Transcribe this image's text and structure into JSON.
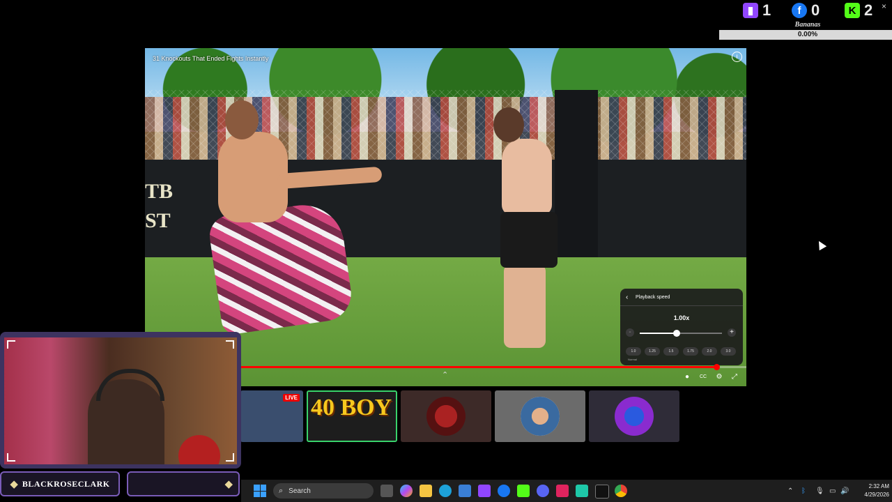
{
  "social": {
    "twitch_count": "1",
    "facebook_count": "0",
    "kick_count": "2",
    "close_glyph": "×",
    "goal_name": "Bananas",
    "goal_percent": "0.00%"
  },
  "player": {
    "video_title": "31 Knockouts That Ended Fights Instantly",
    "info_glyph": "i",
    "wall_text_line1": "TB",
    "wall_text_line2": "ST",
    "progress": 0.95,
    "expand_glyph": "⌃",
    "controls": [
      "●",
      "CC",
      "⚙",
      "⤢"
    ]
  },
  "speed_panel": {
    "back_glyph": "‹",
    "title": "Playback speed",
    "current": "1.00x",
    "minus_glyph": "-",
    "plus_glyph": "+",
    "slider_value": 0.45,
    "presets": [
      "1.0",
      "1.25",
      "1.5",
      "1.75",
      "2.0",
      "3.0"
    ],
    "normal_label": "Normal"
  },
  "recommendations": {
    "live_badge": "LIVE",
    "thumb_1_text": "40 BOY"
  },
  "streamer": {
    "name": "BLACKROSECLARK",
    "gem_glyph": "◆"
  },
  "taskbar": {
    "search_placeholder": "Search",
    "search_glyph": "⌕",
    "time": "2:32 AM",
    "date": "4/29/2026",
    "tray_glyphs": [
      "⌃",
      "ᛒ",
      "🎙",
      "▭",
      "🔊"
    ]
  },
  "colors": {
    "twitch": "#9146ff",
    "facebook": "#1877f2",
    "kick": "#53fc18",
    "progress_red": "#ff0000",
    "accent_purple": "#7a5cb8"
  }
}
